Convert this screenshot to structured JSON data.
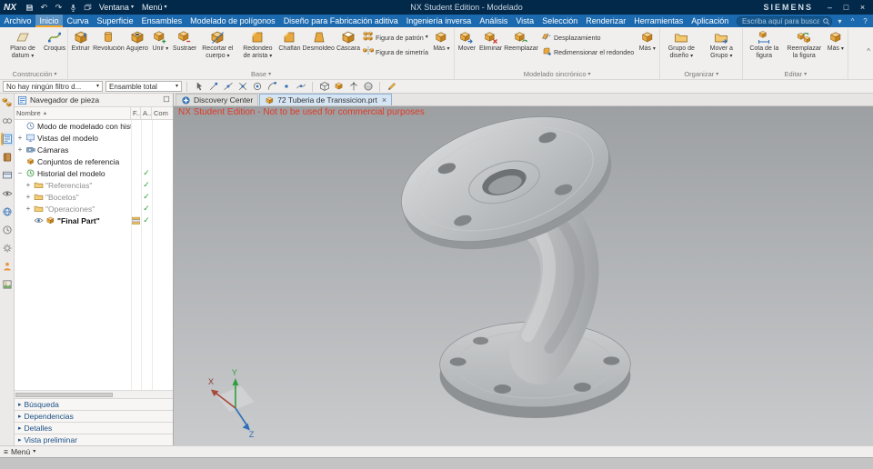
{
  "icons": {
    "dropdown": "▾",
    "undo": "↶",
    "redo": "↷",
    "check": "✓",
    "sort_asc": "▲",
    "section_arrow": "▸",
    "menu_grid": "≡",
    "window_min": "–",
    "window_max": "□",
    "window_close": "×",
    "close_tab": "×",
    "help": "?",
    "chevron_up": "^",
    "chevron_down": "▾"
  },
  "titlebar": {
    "logo": "NX",
    "window_menu_label": "Ventana",
    "menu_label": "Menú",
    "title": "NX Student Edition - Modelado",
    "brand": "SIEMENS"
  },
  "menubar": {
    "tabs": [
      "Archivo",
      "Inicio",
      "Curva",
      "Superficie",
      "Ensambles",
      "Modelado de polígonos",
      "Diseño para Fabricación aditiva",
      "Ingeniería inversa",
      "Análisis",
      "Vista",
      "Selección",
      "Renderizar",
      "Herramientas",
      "Aplicación"
    ],
    "active_tab": "Inicio",
    "search_placeholder": "Escriba aquí para buscar"
  },
  "ribbon": {
    "groups": [
      {
        "name": "Construcción",
        "items": [
          {
            "label": "Plano de datum",
            "icon": "datum-plane",
            "type": "big",
            "arrow": true
          },
          {
            "label": "Croquis",
            "icon": "sketch",
            "type": "big"
          }
        ]
      },
      {
        "name": "Base",
        "items": [
          {
            "label": "Extruir",
            "icon": "extrude",
            "type": "big"
          },
          {
            "label": "Revolución",
            "icon": "revolve",
            "type": "big"
          },
          {
            "label": "Agujero",
            "icon": "hole",
            "type": "big"
          },
          {
            "label": "Unir",
            "icon": "unite",
            "type": "big",
            "arrow": true
          },
          {
            "label": "Sustraer",
            "icon": "subtract",
            "type": "big"
          },
          {
            "label": "Recortar el cuerpo",
            "icon": "trim",
            "type": "big",
            "arrow": true
          },
          {
            "label": "Redondeo de arista",
            "icon": "blend",
            "type": "big",
            "arrow": true
          },
          {
            "label": "Chaflán",
            "icon": "chamfer",
            "type": "big"
          },
          {
            "label": "Desmoldeo",
            "icon": "draft",
            "type": "big"
          },
          {
            "label": "Cáscara",
            "icon": "shell",
            "type": "big"
          },
          {
            "label": "Figura de patrón",
            "icon": "pattern",
            "type": "small",
            "arrow": true
          },
          {
            "label": "Figura de simetría",
            "icon": "mirror",
            "type": "small"
          },
          {
            "label": "Más",
            "icon": "more",
            "type": "big",
            "arrow": true
          }
        ]
      },
      {
        "name": "Modelado sincrónico",
        "items": [
          {
            "label": "Mover",
            "icon": "move",
            "type": "big"
          },
          {
            "label": "Eliminar",
            "icon": "delete-face",
            "type": "big"
          },
          {
            "label": "Reemplazar",
            "icon": "replace-face",
            "type": "big"
          },
          {
            "label": "Desplazamiento",
            "icon": "offset",
            "type": "small"
          },
          {
            "label": "Redimensionar el redondeo",
            "icon": "resize-blend",
            "type": "small"
          },
          {
            "label": "Más",
            "icon": "more",
            "type": "big",
            "arrow": true
          }
        ]
      },
      {
        "name": "Organizar",
        "items": [
          {
            "label": "Grupo de diseño",
            "icon": "design-group",
            "type": "big",
            "arrow": true
          },
          {
            "label": "Mover a Grupo",
            "icon": "move-to-group",
            "type": "big",
            "arrow": true
          }
        ]
      },
      {
        "name": "Editar",
        "items": [
          {
            "label": "Cota de la figura",
            "icon": "feature-dim",
            "type": "big"
          },
          {
            "label": "Reemplazar la figura",
            "icon": "replace-feature",
            "type": "big"
          },
          {
            "label": "Más",
            "icon": "more",
            "type": "big",
            "arrow": true
          }
        ]
      }
    ]
  },
  "filterbar": {
    "filter_value": "No hay ningún filtro d...",
    "scope_value": "Ensamble total",
    "icons_a": [
      "select-touch-icon",
      "snap-endpoint-icon",
      "snap-midpoint-icon",
      "snap-intersection-icon",
      "snap-center-icon",
      "snap-quadrant-icon",
      "snap-point-icon",
      "snap-on-curve-icon"
    ],
    "icons_b": [
      "wireframe-display-icon",
      "shaded-display-icon",
      "view-orientation-icon",
      "render-style-icon"
    ],
    "edit_icon": "edit-section-icon"
  },
  "left_strip": {
    "items": [
      "assembly-navigator-icon",
      "constraint-navigator-icon",
      "part-navigator-icon",
      "reuse-library-icon",
      "view-manager-icon",
      "visualization-icon",
      "web-browser-icon",
      "history-icon",
      "process-studio-icon",
      "roles-icon",
      "system-scenes-icon"
    ],
    "active": "part-navigator-icon"
  },
  "navigator": {
    "title": "Navegador de pieza",
    "columns": [
      "Nombre",
      "F...",
      "A...",
      "Com"
    ],
    "tree": [
      {
        "label": "Modo de modelado con histo...",
        "icon": "history-mode",
        "level": 0
      },
      {
        "label": "Vistas del modelo",
        "icon": "model-views",
        "level": 0,
        "expand": "+"
      },
      {
        "label": "Cámaras",
        "icon": "camera",
        "level": 0,
        "expand": "+"
      },
      {
        "label": "Conjuntos de referencia",
        "icon": "reference-set",
        "level": 0
      },
      {
        "label": "Historial del modelo",
        "icon": "model-history",
        "level": 0,
        "expand": "−",
        "check": true
      },
      {
        "label": "\"Referencias\"",
        "icon": "folder",
        "level": 1,
        "expand": "+",
        "check": true,
        "dim": true
      },
      {
        "label": "\"Bocetos\"",
        "icon": "folder",
        "level": 1,
        "expand": "+",
        "check": true,
        "dim": true
      },
      {
        "label": "\"Operaciones\"",
        "icon": "folder",
        "level": 1,
        "expand": "+",
        "check": true,
        "dim": true
      },
      {
        "label": "\"Final Part\"",
        "icon": "solid-part",
        "level": 1,
        "eye": true,
        "check": true,
        "bold": true,
        "fstack": true
      }
    ],
    "sections": [
      "Búsqueda",
      "Dependencias",
      "Detalles",
      "Vista preliminar"
    ]
  },
  "doc_tabs": [
    {
      "label": "Discovery Center",
      "active": false,
      "closable": false
    },
    {
      "label": "72 Tuberia de Transsicion.prt",
      "active": true,
      "closable": true
    }
  ],
  "viewport": {
    "watermark": "NX Student Edition - Not to be used for commercial purposes",
    "triad": {
      "x": "X",
      "y": "Y",
      "z": "Z"
    }
  },
  "statusbar": {
    "menu_label": "Menú"
  }
}
